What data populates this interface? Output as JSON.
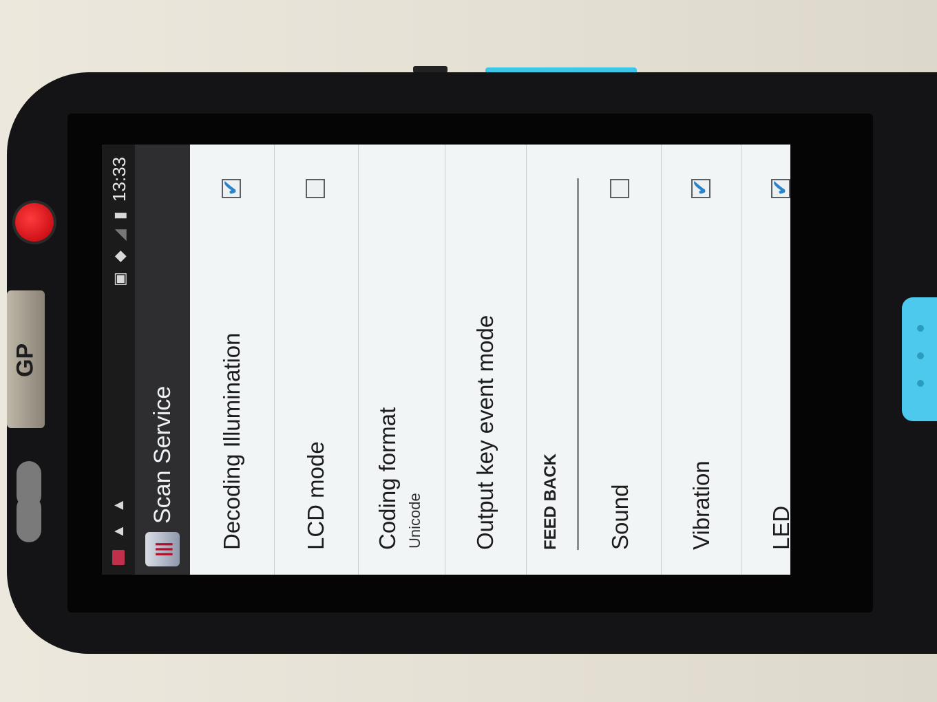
{
  "device": {
    "brand": "GP"
  },
  "status_bar": {
    "time": "13:33",
    "icons_left": [
      "barcode-app-icon",
      "warning-icon",
      "warning-icon"
    ],
    "icons_right": [
      "sim-icon",
      "wifi-icon",
      "signal-icon",
      "battery-icon"
    ]
  },
  "app_bar": {
    "title": "Scan Service",
    "icon": "barcode-app-icon"
  },
  "settings": {
    "decoding_illumination": {
      "label": "Decoding Illumination",
      "checked": true
    },
    "lcd_mode": {
      "label": "LCD mode",
      "checked": false
    },
    "coding_format": {
      "label": "Coding format",
      "value": "Unicode"
    },
    "output_key_event_mode": {
      "label": "Output key event mode"
    },
    "feedback_section": {
      "label": "FEED BACK"
    },
    "sound": {
      "label": "Sound",
      "checked": false
    },
    "vibration": {
      "label": "Vibration",
      "checked": true
    },
    "led": {
      "label": "LED",
      "checked": true
    }
  },
  "colors": {
    "checkmark": "#2b84c9",
    "scan_key": "#4cc9ec",
    "power_button": "#e0101e"
  }
}
